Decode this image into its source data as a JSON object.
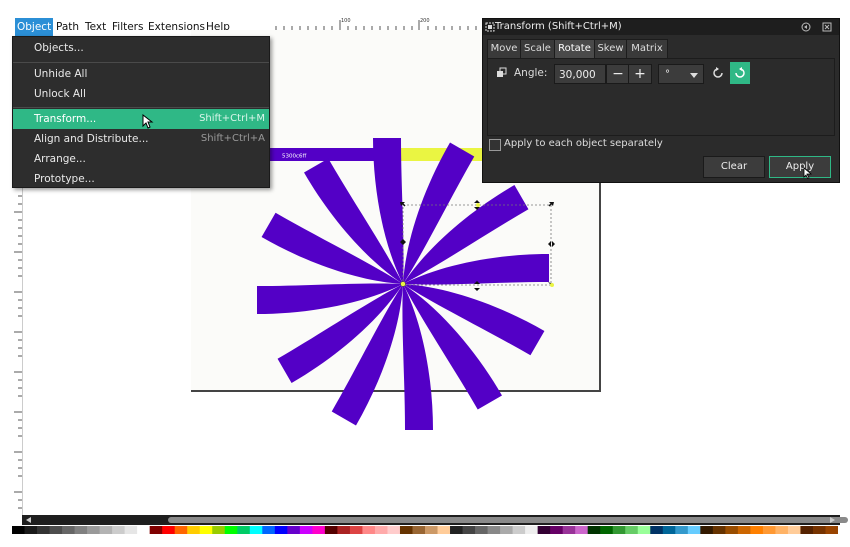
{
  "menubar": {
    "items": [
      "Object",
      "Path",
      "Text",
      "Filters",
      "Extensions",
      "Help"
    ],
    "active_index": 0
  },
  "ruler": {
    "labels": [
      "100",
      "200"
    ]
  },
  "object_menu": {
    "items": [
      {
        "label": "Objects...",
        "shortcut": ""
      },
      {
        "label": "Unhide All",
        "shortcut": ""
      },
      {
        "label": "Unlock All",
        "shortcut": ""
      },
      {
        "label": "Transform...",
        "shortcut": "Shift+Ctrl+M",
        "highlighted": true
      },
      {
        "label": "Align and Distribute...",
        "shortcut": "Shift+Ctrl+A"
      },
      {
        "label": "Arrange...",
        "shortcut": ""
      },
      {
        "label": "Prototype...",
        "shortcut": ""
      }
    ]
  },
  "canvas": {
    "swatch_label": "5300c6ff",
    "fill_color": "#5300c6",
    "accent_yellow": "#eaf542"
  },
  "transform_dialog": {
    "title": "Transform (Shift+Ctrl+M)",
    "tabs": [
      "Move",
      "Scale",
      "Rotate",
      "Skew",
      "Matrix"
    ],
    "selected_tab": "Rotate",
    "angle_label": "Angle:",
    "angle_value": "30,000",
    "unit": "°",
    "apply_each_label": "Apply to each object separately",
    "clear_label": "Clear",
    "apply_label": "Apply",
    "accent": "#2fb886"
  }
}
